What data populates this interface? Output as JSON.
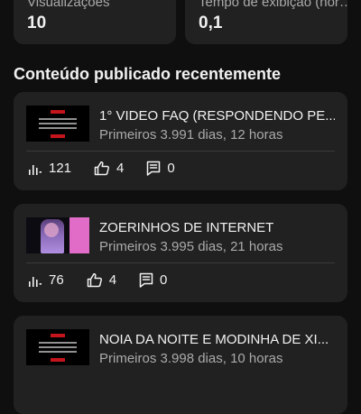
{
  "stats": [
    {
      "label": "Visualizações",
      "value": "10"
    },
    {
      "label": "Tempo de exibição (hor…",
      "value": "0,1"
    }
  ],
  "section_title": "Conteúdo publicado recentemente",
  "videos": [
    {
      "title": "1° VIDEO FAQ (RESPONDENDO PE...",
      "subtitle": "Primeiros 3.991 dias, 12 horas",
      "views": "121",
      "likes": "4",
      "comments": "0"
    },
    {
      "title": "ZOERINHOS DE INTERNET",
      "subtitle": "Primeiros 3.995 dias, 21 horas",
      "views": "76",
      "likes": "4",
      "comments": "0"
    },
    {
      "title": "NOIA DA NOITE E MODINHA DE XI...",
      "subtitle": "Primeiros 3.998 dias, 10 horas",
      "views": "",
      "likes": "",
      "comments": ""
    }
  ],
  "icons": {
    "views": "bar-chart-icon",
    "likes": "thumbs-up-icon",
    "comments": "comment-icon"
  },
  "colors": {
    "background": "#0f0f0f",
    "card": "#212121",
    "text": "#f1f1f1",
    "secondary_text": "#aaaaaa",
    "thumbnail_red": "#c4151c"
  }
}
